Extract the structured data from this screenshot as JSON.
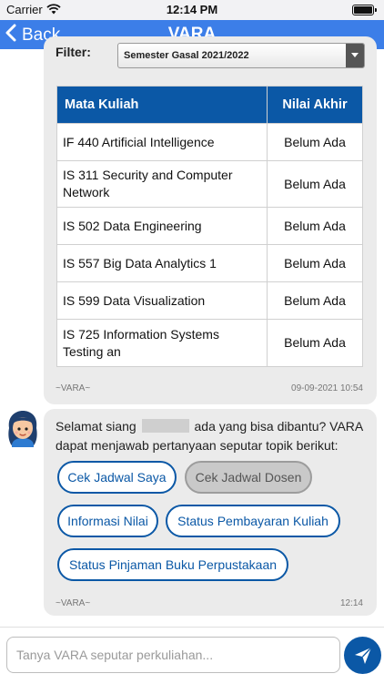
{
  "status_bar": {
    "carrier": "Carrier",
    "time": "12:14 PM"
  },
  "nav": {
    "back_label": "Back",
    "title": "VARA"
  },
  "grades_message": {
    "filter_label": "Filter:",
    "filter_value": "Semester Gasal 2021/2022",
    "columns": [
      "Mata Kuliah",
      "Nilai Akhir"
    ],
    "rows": [
      {
        "course": "IF 440 Artificial Intelligence",
        "grade": "Belum Ada"
      },
      {
        "course": "IS 311 Security and Computer Network",
        "grade": "Belum Ada"
      },
      {
        "course": "IS 502 Data Engineering",
        "grade": "Belum Ada"
      },
      {
        "course": "IS 557 Big Data Analytics 1",
        "grade": "Belum Ada"
      },
      {
        "course": "IS 599 Data Visualization",
        "grade": "Belum Ada"
      },
      {
        "course": "IS 725 Information Systems Testing an",
        "grade": "Belum Ada"
      }
    ],
    "sender": "~VARA~",
    "timestamp": "09-09-2021 10:54"
  },
  "greeting_message": {
    "text_before": "Selamat siang",
    "text_after": "ada yang bisa dibantu? VARA dapat menjawab pertanyaan seputar topik berikut:",
    "options": [
      {
        "label": "Cek Jadwal Saya",
        "state": "enabled"
      },
      {
        "label": "Cek Jadwal Dosen",
        "state": "disabled"
      },
      {
        "label": "Informasi Nilai",
        "state": "enabled"
      },
      {
        "label": "Status Pembayaran Kuliah",
        "state": "enabled"
      },
      {
        "label": "Status Pinjaman Buku Perpustakaan",
        "state": "enabled"
      }
    ],
    "sender": "~VARA~",
    "timestamp": "12:14"
  },
  "composer": {
    "placeholder": "Tanya VARA seputar perkuliahan..."
  },
  "icons": {
    "back": "chevron-left-icon",
    "send": "paper-plane-icon",
    "avatar": "avatar-girl-icon"
  },
  "colors": {
    "nav": "#3c7ee8",
    "accent": "#0b58a6",
    "bubble": "#ebebeb"
  }
}
